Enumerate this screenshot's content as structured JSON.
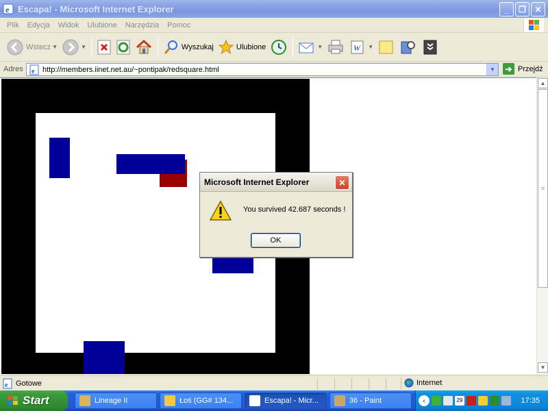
{
  "window": {
    "title": "Escapa! - Microsoft Internet Explorer",
    "buttons": {
      "minimize": "_",
      "maximize": "❐",
      "close": "✕"
    }
  },
  "menu": [
    "Plik",
    "Edycja",
    "Widok",
    "Ulubione",
    "Narzędzia",
    "Pomoc"
  ],
  "toolbar": {
    "back_label": "Wstecz",
    "search_label": "Wyszukaj",
    "favorites_label": "Ulubione"
  },
  "address": {
    "label": "Adres",
    "url": "http://members.iinet.net.au/~pontipak/redsquare.html",
    "go_label": "Przejdź"
  },
  "status": {
    "text": "Gotowe",
    "zone": "Internet"
  },
  "dialog": {
    "title": "Microsoft Internet Explorer",
    "message": "You survived 42.687 seconds !",
    "ok_label": "OK",
    "close": "✕"
  },
  "colors": {
    "enemy": "#000099",
    "player": "#990000",
    "board_border": "#000000"
  },
  "taskbar": {
    "start_label": "Start",
    "tasks": [
      {
        "label": "Lineage II",
        "active": false
      },
      {
        "label": "Łoś (GG# 134...",
        "active": false
      },
      {
        "label": "Escapa! - Micr...",
        "active": true
      },
      {
        "label": "36 - Paint",
        "active": false
      }
    ],
    "clock": "17:35",
    "tray_date_badge": "29"
  }
}
